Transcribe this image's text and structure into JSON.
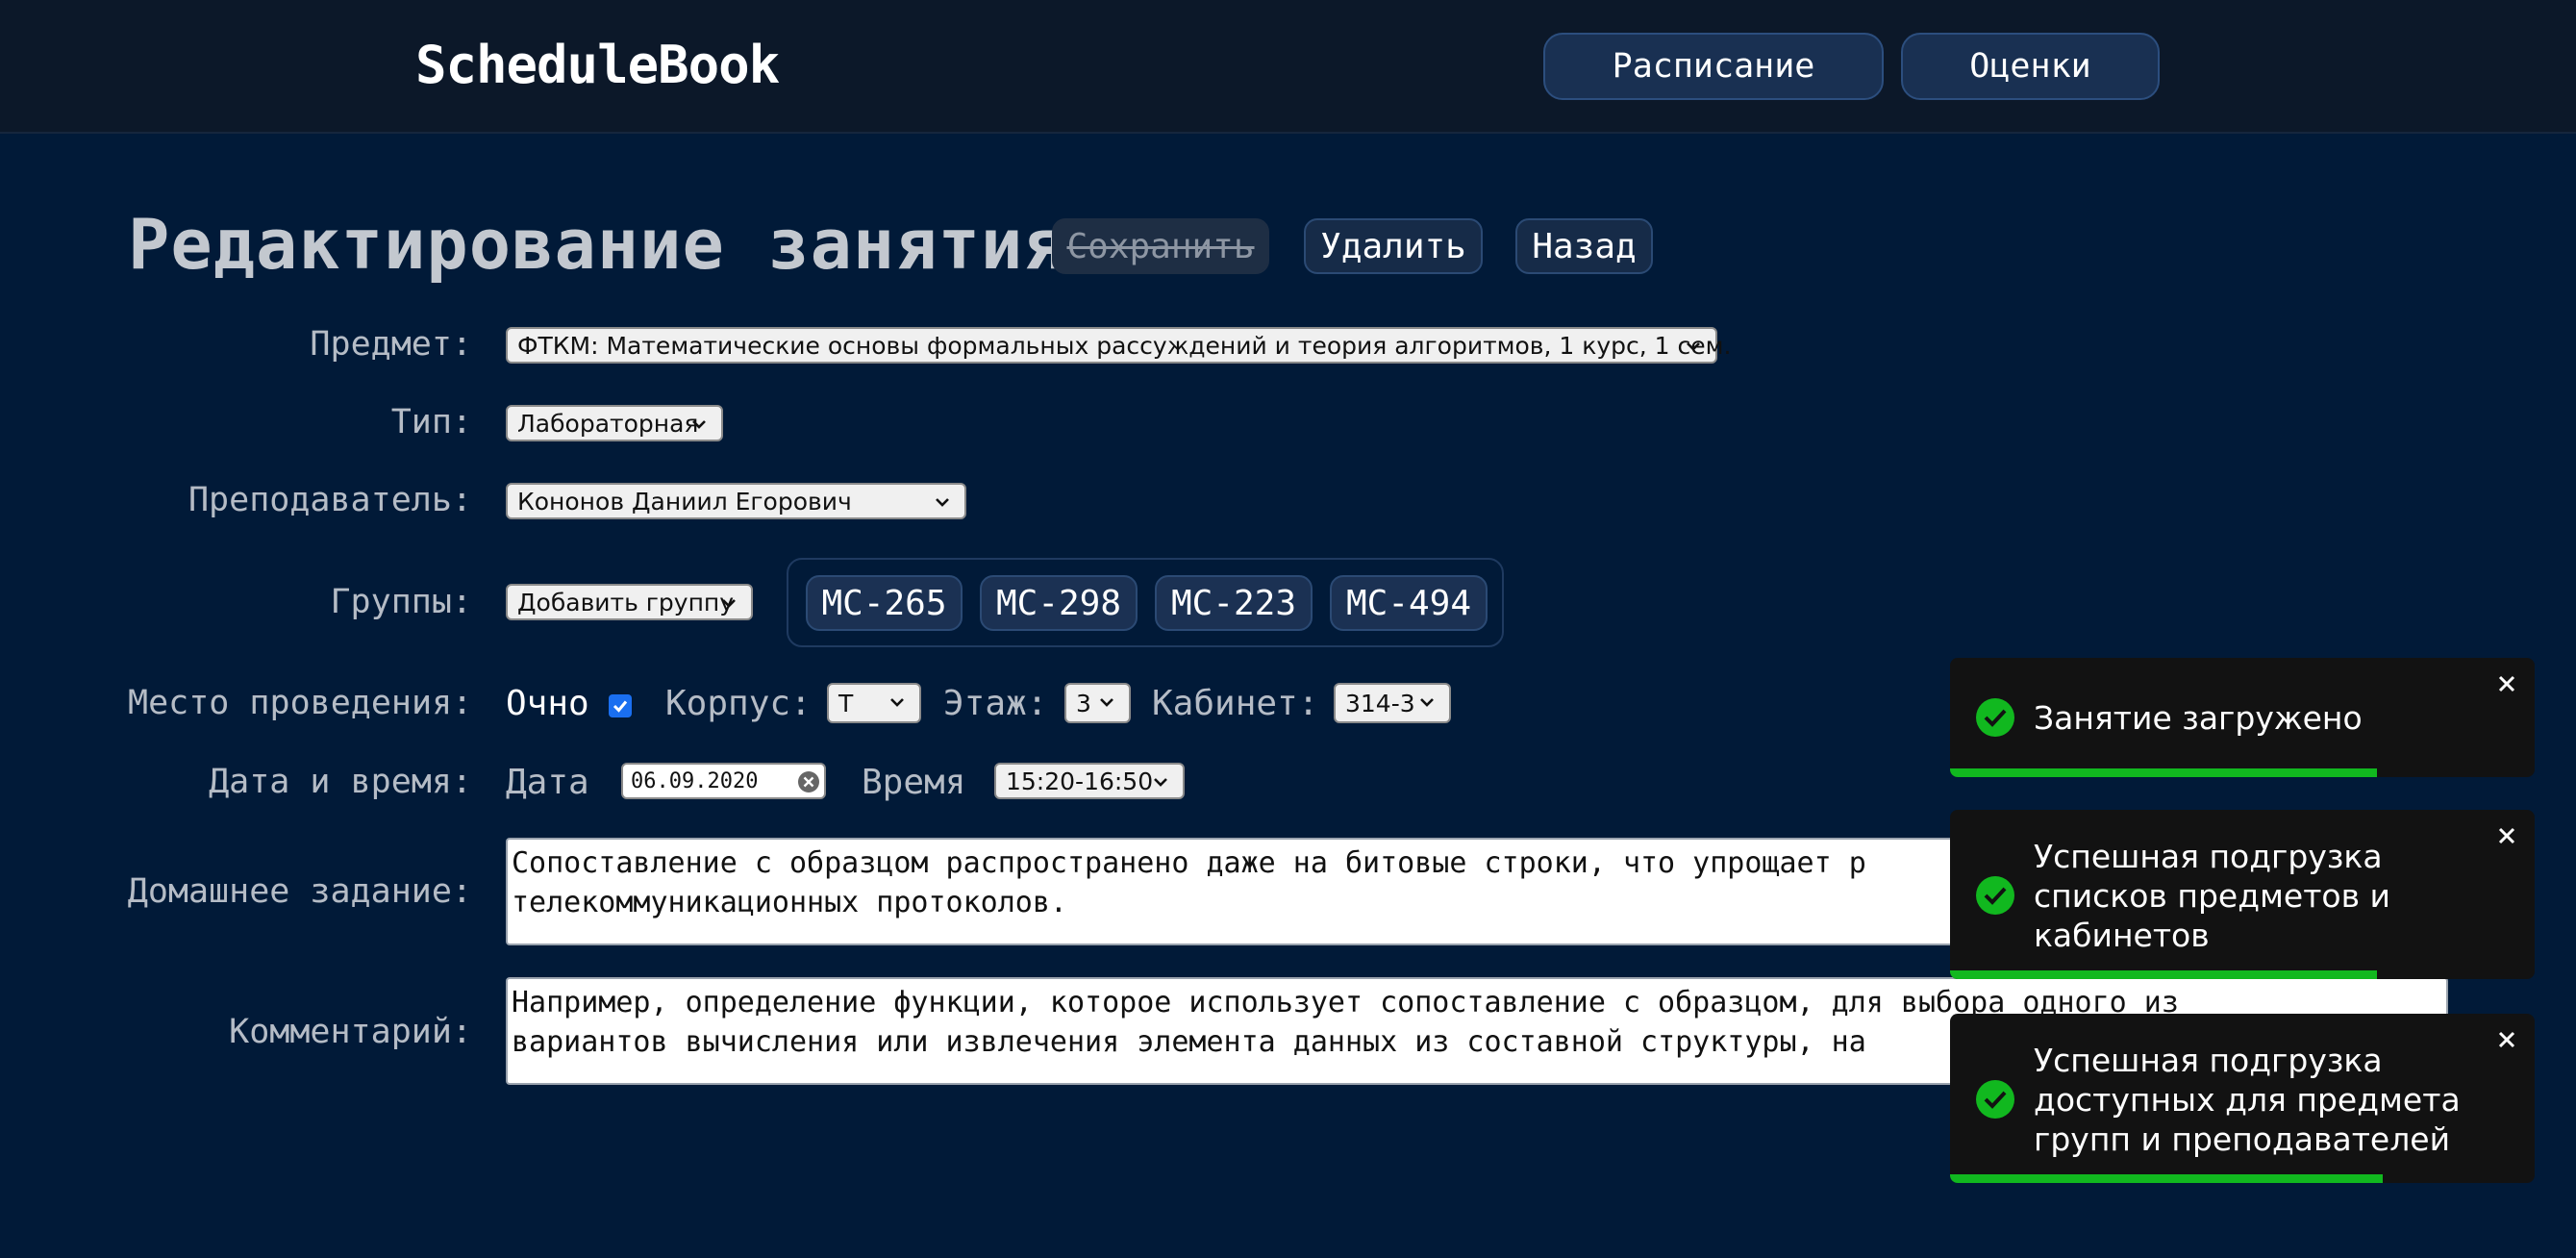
{
  "header": {
    "logo": "ScheduleBook",
    "nav": [
      "Расписание",
      "Оценки"
    ]
  },
  "page": {
    "title": "Редактирование занятия",
    "buttons": {
      "save": "Сохранить",
      "delete": "Удалить",
      "back": "Назад"
    }
  },
  "form": {
    "subject_label": "Предмет:",
    "subject_value": "ФТКМ: Математические основы формальных рассуждений и теория алгоритмов, 1 курс, 1 сем.",
    "type_label": "Тип:",
    "type_value": "Лабораторная",
    "teacher_label": "Преподаватель:",
    "teacher_value": "Кононов Даниил Егорович",
    "groups_label": "Группы:",
    "groups_select": "Добавить группу",
    "groups": [
      "МС-265",
      "МС-298",
      "МС-223",
      "МС-494"
    ],
    "place_label": "Место проведения:",
    "inperson_label": "Очно",
    "inperson_checked": true,
    "building_label": "Корпус:",
    "building_value": "Т",
    "floor_label": "Этаж:",
    "floor_value": "3",
    "room_label": "Кабинет:",
    "room_value": "314-3",
    "datetime_label": "Дата и время:",
    "date_label": "Дата",
    "date_value": "06.09.2020",
    "time_label": "Время",
    "time_value": "15:20-16:50",
    "homework_label": "Домашнее задание:",
    "homework_line1": "Сопоставление с образцом распространено даже на битовые строки, что упрощает р",
    "homework_line2": "телекоммуникационных протоколов.",
    "comment_label": "Комментарий:",
    "comment_line1": "Например, определение функции, которое использует сопоставление с образцом, для выбора одного из",
    "comment_line2": "вариантов вычисления или извлечения элемента данных из составной структуры, на"
  },
  "toasts": [
    {
      "text": "Занятие загружено",
      "progress": 0.73
    },
    {
      "text": "Успешная подгрузка списков предметов и кабинетов",
      "progress": 0.73
    },
    {
      "text": "Успешная подгрузка доступных для предмета групп и преподавателей",
      "progress": 0.74
    }
  ],
  "colors": {
    "background": "#011a38",
    "toast_progress": "#11b81f",
    "checkbox": "#1a6ff0"
  }
}
